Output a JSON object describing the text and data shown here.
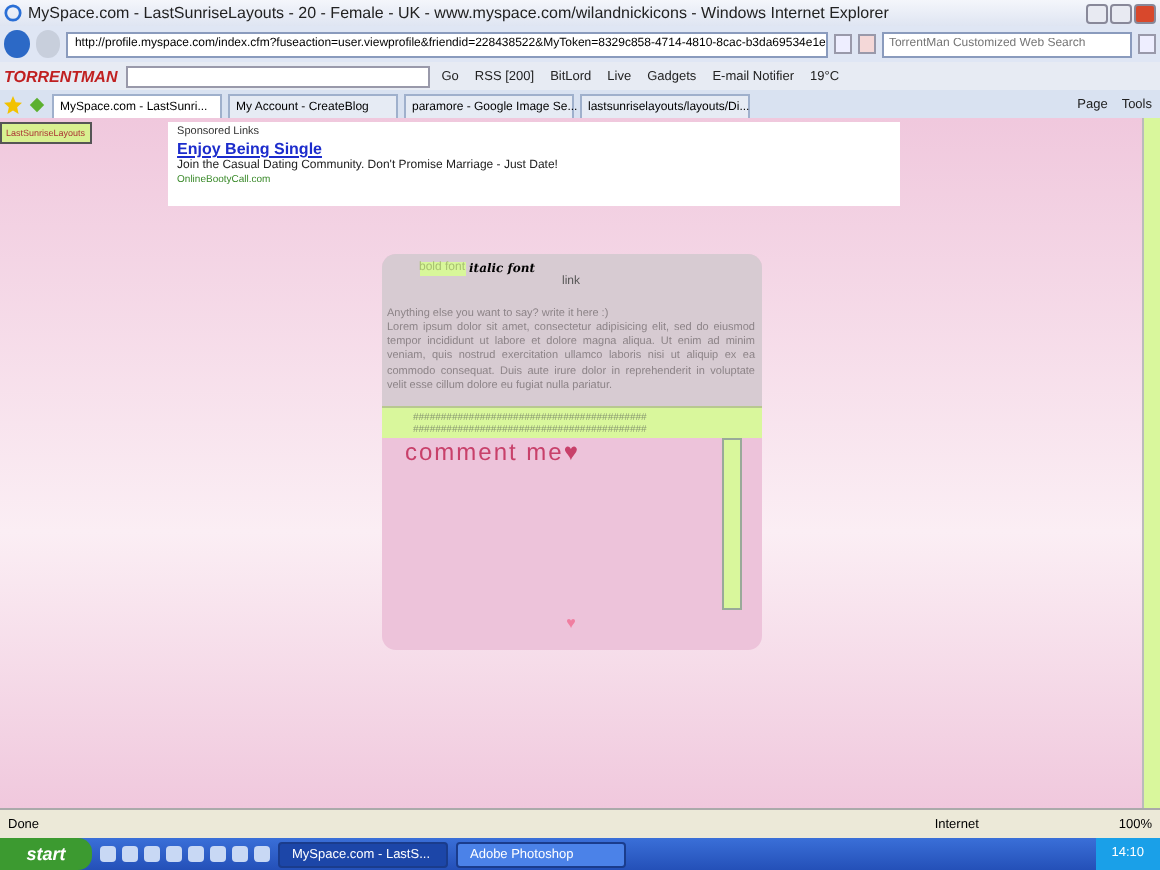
{
  "window": {
    "title": "MySpace.com - LastSunriseLayouts - 20 - Female - UK - www.myspace.com/wilandnickicons - Windows Internet Explorer"
  },
  "address_bar": {
    "url": "http://profile.myspace.com/index.cfm?fuseaction=user.viewprofile&friendid=228438522&MyToken=8329c858-4714-4810-8cac-b3da69534e1e",
    "search_placeholder": "TorrentMan Customized Web Search"
  },
  "toolbar": {
    "brand": "TORRENTMAN",
    "items": [
      {
        "label": "Go"
      },
      {
        "label": "RSS [200]"
      },
      {
        "label": "BitLord"
      },
      {
        "label": "Live"
      },
      {
        "label": "Gadgets"
      },
      {
        "label": "E-mail Notifier"
      },
      {
        "label": "19°C"
      }
    ]
  },
  "tabs": [
    {
      "label": "MySpace.com - LastSunri...",
      "selected": true
    },
    {
      "label": "My Account - CreateBlog",
      "selected": false
    },
    {
      "label": "paramore - Google Image Se...",
      "selected": false
    },
    {
      "label": "lastsunriselayouts/layouts/Di...",
      "selected": false
    }
  ],
  "command_bar": [
    "Page",
    "Tools"
  ],
  "page": {
    "badge": "LastSunriseLayouts",
    "ad": {
      "heading": "Sponsored Links",
      "title": "Enjoy Being Single",
      "text": "Join the Casual Dating Community. Don't Promise Marriage - Just Date!",
      "url": "OnlineBootyCall.com"
    },
    "card": {
      "bold": "bold font",
      "italic": "italic font",
      "link": "link",
      "intro": "Anything else you want to say? write it here :)",
      "body": "Lorem ipsum dolor sit amet, consectetur adipisicing elit, sed do eiusmod tempor incididunt ut labore et dolore magna aliqua. Ut enim ad minim veniam, quis nostrud exercitation ullamco laboris nisi ut aliquip ex ea commodo consequat. Duis aute irure dolor in reprehenderit in voluptate velit esse cillum dolore eu fugiat nulla pariatur.",
      "divider_rows": [
        "##########################################",
        "##########################################"
      ],
      "comment_title": "comment me♥",
      "heart": "♥"
    }
  },
  "status_bar": {
    "status": "Done",
    "zone": "Internet",
    "zoom": "100%"
  },
  "taskbar": {
    "start": "start",
    "windows": [
      {
        "label": "MySpace.com - LastS...",
        "selected": true
      },
      {
        "label": "Adobe Photoshop",
        "selected": false
      }
    ],
    "clock": "14:10"
  }
}
